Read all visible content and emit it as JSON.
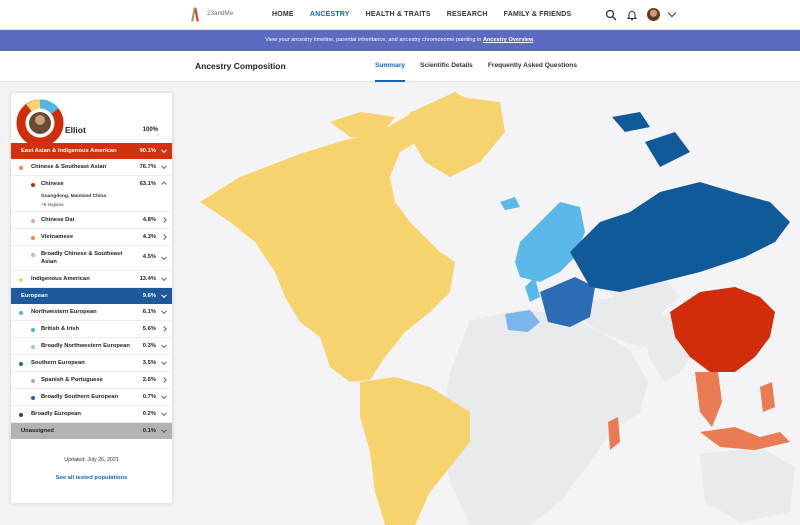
{
  "nav": {
    "logo_text": "23andMe",
    "items": [
      "HOME",
      "ANCESTRY",
      "HEALTH & TRAITS",
      "RESEARCH",
      "FAMILY & FRIENDS"
    ],
    "active": "ANCESTRY",
    "icons": [
      "search-icon",
      "bell-icon",
      "avatar",
      "chevron-down-icon"
    ]
  },
  "banner": {
    "text": "View your ancestry timeline, parental inheritance, and ancestry chromosome painting in",
    "link": "Ancestry Overview",
    "suffix": "."
  },
  "subnav": {
    "title": "Ancestry Composition",
    "tabs": [
      "Summary",
      "Scientific Details",
      "Frequently Asked Questions"
    ],
    "active_tab": "Summary"
  },
  "profile": {
    "name": "Elliot",
    "total": "100%"
  },
  "composition": {
    "east_asian": {
      "label": "East Asian & Indigenous American",
      "pct": "90.1%",
      "color": "#d4300d"
    },
    "chinese_se_asian": {
      "label": "Chinese & Southeast Asian",
      "pct": "76.7%",
      "color": "#e8815c"
    },
    "chinese": {
      "label": "Chinese",
      "pct": "63.1%",
      "color": "#c62808",
      "sub_region": "Guangdong, Mainland China",
      "more": "+6 regions"
    },
    "chinese_dai": {
      "label": "Chinese Dai",
      "pct": "4.8%",
      "color": "#f4a07c"
    },
    "vietnamese": {
      "label": "Vietnamese",
      "pct": "4.3%",
      "color": "#ee8b3c"
    },
    "broadly_chinese": {
      "label": "Broadly Chinese & Southeast Asian",
      "pct": "4.5%",
      "color": "#f0a78a"
    },
    "indigenous_american": {
      "label": "Indigenous American",
      "pct": "13.4%",
      "color": "#f5d06a"
    },
    "european": {
      "label": "European",
      "pct": "9.6%",
      "color": "#1e5a9b"
    },
    "nw_european": {
      "label": "Northwestern European",
      "pct": "6.1%",
      "color": "#4fb8e8"
    },
    "british_irish": {
      "label": "British & Irish",
      "pct": "5.6%",
      "color": "#45b3e6"
    },
    "broadly_nw": {
      "label": "Broadly Northwestern European",
      "pct": "0.3%",
      "color": "#86cdf0"
    },
    "southern_european": {
      "label": "Southern European",
      "pct": "3.5%",
      "color": "#2166a8"
    },
    "spanish_portuguese": {
      "label": "Spanish & Portuguese",
      "pct": "2.6%",
      "color": "#7ab6ec"
    },
    "broadly_southern": {
      "label": "Broadly Southern European",
      "pct": "0.7%",
      "color": "#1f5faa"
    },
    "broadly_european": {
      "label": "Broadly European",
      "pct": "0.2%",
      "color": "#17457f"
    },
    "unassigned": {
      "label": "Unassigned",
      "pct": "0.1%",
      "color": "#b3b3b3"
    }
  },
  "footer": {
    "updated": "Updated: July 26, 2021",
    "see_all": "See all tested populations"
  },
  "map_colors": {
    "americas": "#f6d36c",
    "russia_europe_east": "#105a9a",
    "northern_europe": "#5bb9ea",
    "central_europe": "#2a6db4",
    "china": "#d12d0a",
    "southeast_asia": "#ea7b52",
    "background": "#f4f4f6",
    "land_neutral": "#e9eaee"
  }
}
